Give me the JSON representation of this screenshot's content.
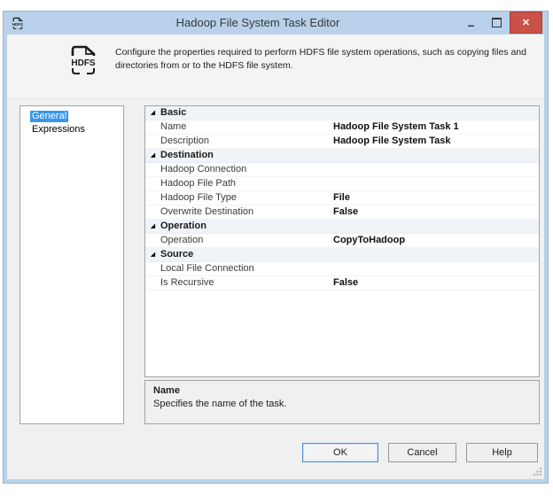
{
  "window": {
    "title": "Hadoop File System Task Editor"
  },
  "icons": {
    "app": "hdfs-document-icon",
    "hdfs_label": "HDFS",
    "minimize_glyph": "–",
    "close_glyph": "✕",
    "expander_glyph": "◢"
  },
  "banner": {
    "description": "Configure the properties required to perform HDFS file system operations, such as copying files and directories from or to the HDFS file system."
  },
  "sidebar": {
    "items": [
      {
        "label": "General",
        "selected": true
      },
      {
        "label": "Expressions",
        "selected": false
      }
    ]
  },
  "property_grid": {
    "sections": [
      {
        "label": "Basic",
        "items": [
          {
            "label": "Name",
            "value": "Hadoop File System Task 1"
          },
          {
            "label": "Description",
            "value": "Hadoop File System Task"
          }
        ]
      },
      {
        "label": "Destination",
        "items": [
          {
            "label": "Hadoop Connection",
            "value": ""
          },
          {
            "label": "Hadoop File Path",
            "value": ""
          },
          {
            "label": "Hadoop File Type",
            "value": "File"
          },
          {
            "label": "Overwrite Destination",
            "value": "False"
          }
        ]
      },
      {
        "label": "Operation",
        "items": [
          {
            "label": "Operation",
            "value": "CopyToHadoop"
          }
        ]
      },
      {
        "label": "Source",
        "items": [
          {
            "label": "Local File Connection",
            "value": ""
          },
          {
            "label": "Is Recursive",
            "value": "False"
          }
        ]
      }
    ]
  },
  "detail_panel": {
    "title": "Name",
    "description": "Specifies the name of the task."
  },
  "footer": {
    "buttons": [
      {
        "label": "OK"
      },
      {
        "label": "Cancel"
      },
      {
        "label": "Help"
      }
    ]
  },
  "colors": {
    "titlebar": "#b9d1ea",
    "close_button": "#c95148",
    "selection": "#3a96ea"
  }
}
